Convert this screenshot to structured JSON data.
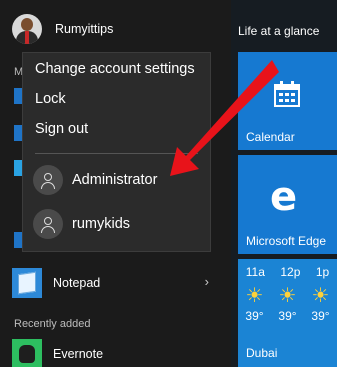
{
  "user": {
    "name": "Rumyittips"
  },
  "left_fragment": {
    "letter": "M"
  },
  "apps": [
    {
      "label": "Notepad",
      "icon": "notepad-icon"
    },
    {
      "label": "Evernote",
      "icon": "evernote-icon"
    }
  ],
  "sections": {
    "recently_added": "Recently added"
  },
  "flyout": {
    "change_account": "Change account settings",
    "lock": "Lock",
    "sign_out": "Sign out",
    "accounts": [
      {
        "name": "Administrator"
      },
      {
        "name": "rumykids"
      }
    ]
  },
  "tiles": {
    "header": "Life at a glance",
    "calendar": "Calendar",
    "edge": "Microsoft Edge",
    "edge_glyph": "e",
    "weather": {
      "times": [
        "11a",
        "12p",
        "1p"
      ],
      "temps": [
        "39°",
        "39°",
        "39°"
      ],
      "icon": "☀",
      "city": "Dubai"
    }
  },
  "colors": {
    "tile_blue": "#1679d1",
    "arrow_red": "#e8131a"
  }
}
